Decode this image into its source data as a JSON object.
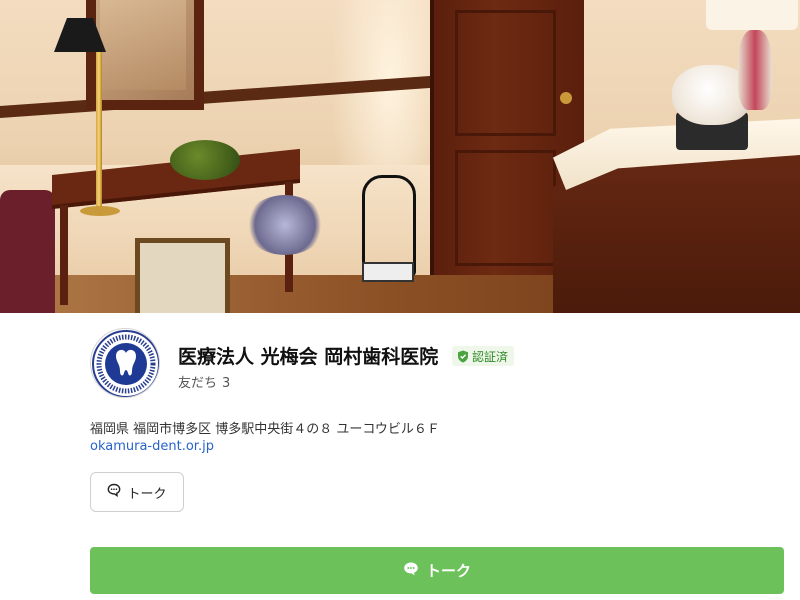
{
  "cover": {
    "alt": ""
  },
  "profile": {
    "name": "医療法人 光梅会 岡村歯科医院",
    "verified_label": "認証済",
    "friends_label": "友だち",
    "friends_count": "3",
    "logo_icon": "clinic-logo-icon"
  },
  "info": {
    "address": "福岡県 福岡市博多区 博多駅中央街４の８ ユーコウビル６Ｆ",
    "website": "okamura-dent.or.jp"
  },
  "actions": {
    "talk_small_label": "トーク",
    "talk_big_label": "トーク"
  },
  "colors": {
    "primary_green": "#6cc15a",
    "verified_green": "#2e8a26",
    "link_blue": "#2a63c9"
  }
}
